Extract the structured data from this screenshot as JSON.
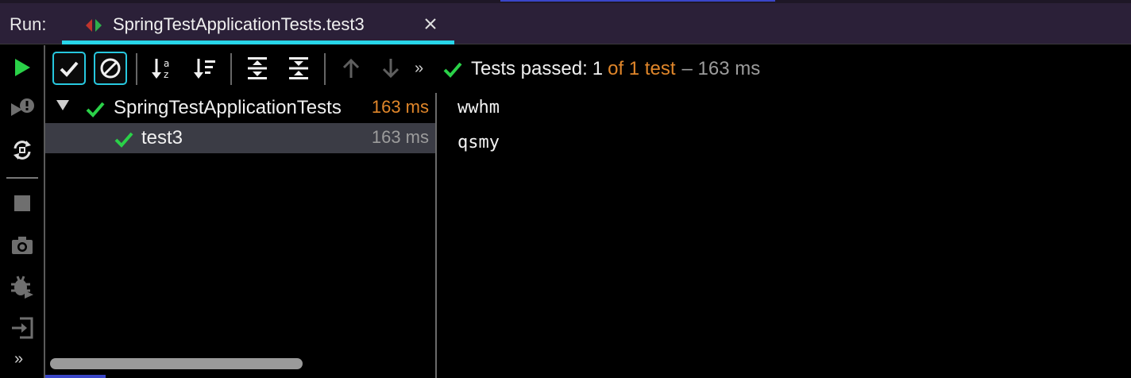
{
  "run_bar": {
    "label": "Run:",
    "tab": {
      "title": "SpringTestApplicationTests.test3",
      "icon": "run-config-icon",
      "close_icon": "close-icon"
    }
  },
  "left_toolbar": {
    "items": [
      {
        "name": "rerun",
        "icon": "play-icon"
      },
      {
        "name": "rerun-failed",
        "icon": "rerun-failed-icon"
      },
      {
        "name": "toggle-auto-test",
        "icon": "auto-test-icon"
      },
      {
        "name": "stop",
        "icon": "stop-icon"
      },
      {
        "name": "dump-threads",
        "icon": "camera-icon"
      },
      {
        "name": "debug",
        "icon": "bug-icon"
      },
      {
        "name": "exit",
        "icon": "exit-icon"
      }
    ],
    "more_label": "»"
  },
  "main_toolbar": {
    "buttons": [
      {
        "name": "show-passed",
        "icon": "checkmark-icon",
        "toggled": true
      },
      {
        "name": "show-ignored",
        "icon": "ignored-icon",
        "toggled": true
      },
      {
        "name": "sort-alphabetically",
        "icon": "sort-alpha-icon",
        "toggled": false
      },
      {
        "name": "sort-by-duration",
        "icon": "sort-duration-icon",
        "toggled": false
      },
      {
        "name": "expand-all",
        "icon": "expand-all-icon",
        "toggled": false
      },
      {
        "name": "collapse-all",
        "icon": "collapse-all-icon",
        "toggled": false
      },
      {
        "name": "previous-test",
        "icon": "arrow-up-icon",
        "toggled": false
      },
      {
        "name": "next-test",
        "icon": "arrow-down-icon",
        "toggled": false
      }
    ],
    "more_label": "»",
    "status": {
      "main": "Tests passed:",
      "count": "1",
      "of_total": "of 1 test",
      "time": "– 163 ms"
    }
  },
  "tree": {
    "rows": [
      {
        "name": "SpringTestApplicationTests",
        "duration": "163 ms",
        "duration_color": "#e0862a",
        "expanded": true,
        "selected": false
      },
      {
        "name": "test3",
        "duration": "163 ms",
        "duration_color": "#9c9c9c",
        "selected": true
      }
    ]
  },
  "console": {
    "lines": [
      "wwhm",
      "qsmy"
    ]
  },
  "colors": {
    "accent_cyan": "#28d6ea",
    "pass_green": "#2ad148",
    "duration_orange": "#e0862a",
    "run_bar_bg": "#2b2038"
  }
}
